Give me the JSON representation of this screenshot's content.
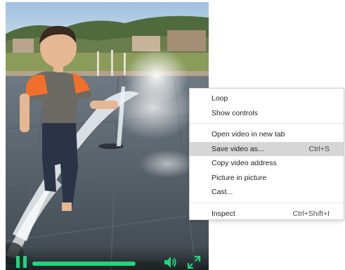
{
  "video": {
    "playback_progress": 0.8,
    "accent_color": "#1ed67c",
    "icons": {
      "pause": "pause-icon",
      "volume": "volume-icon",
      "fullscreen": "fullscreen-icon"
    }
  },
  "context_menu": {
    "groups": [
      [
        {
          "label": "Loop",
          "shortcut": ""
        },
        {
          "label": "Show controls",
          "shortcut": ""
        }
      ],
      [
        {
          "label": "Open video in new tab",
          "shortcut": ""
        },
        {
          "label": "Save video as...",
          "shortcut": "Ctrl+S",
          "highlighted": true
        },
        {
          "label": "Copy video address",
          "shortcut": ""
        },
        {
          "label": "Picture in picture",
          "shortcut": ""
        },
        {
          "label": "Cast...",
          "shortcut": ""
        }
      ],
      [
        {
          "label": "Inspect",
          "shortcut": "Ctrl+Shift+I"
        }
      ]
    ]
  }
}
